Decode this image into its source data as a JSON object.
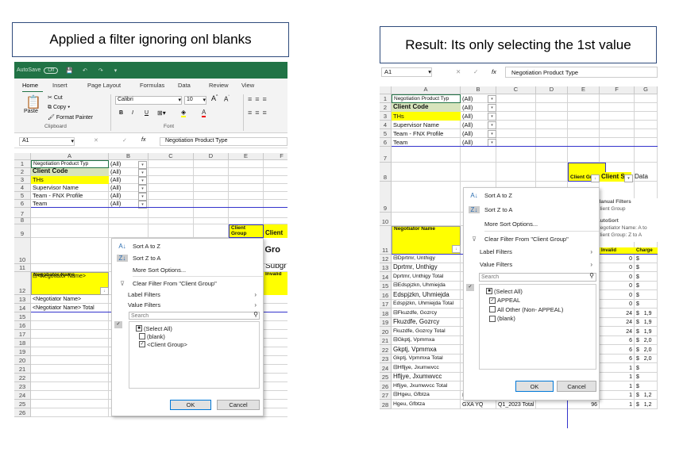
{
  "captions": {
    "left": "Applied a filter ignoring onl blanks",
    "right": "Result: Its only selecting the 1st value"
  },
  "colors": {
    "excel_green": "#217346",
    "header_yellow": "#ffff00",
    "pivot_border": "#3333cc"
  },
  "left": {
    "titlebar": {
      "autosave": "AutoSave",
      "toggle": "Off"
    },
    "tabs": [
      "Home",
      "Insert",
      "Page Layout",
      "Formulas",
      "Data",
      "Review",
      "View"
    ],
    "clipboard": {
      "paste": "Paste",
      "cut": "Cut",
      "copy": "Copy",
      "format_painter": "Format Painter",
      "group": "Clipboard"
    },
    "font": {
      "name": "Calibri",
      "size": "10",
      "group": "Font",
      "bold": "B",
      "italic": "I",
      "underline": "U"
    },
    "name_box": "A1",
    "formula": "Negotiation Product Type",
    "columns": [
      "A",
      "B",
      "C",
      "D",
      "E",
      "F"
    ],
    "filters": [
      {
        "label": "Negotiation Product Typ",
        "value": "(All)"
      },
      {
        "label": "Client Code",
        "value": "(All)"
      },
      {
        "label": "THs",
        "value": "(All)"
      },
      {
        "label": "Supervisor Name",
        "value": "(All)"
      },
      {
        "label": "Team - FNX Profile",
        "value": "(All)"
      },
      {
        "label": "Team",
        "value": "(All)"
      }
    ],
    "client_group_header": "Client Group",
    "client_partial": "Client",
    "title_partial": "nt Gro",
    "subgroup_partial": "Subgr",
    "negotiator_header": "Negotiator Name",
    "invalid_header": "Invalid",
    "rows": [
      "⊟<Negotiator Name>",
      "<Negotiator Name>",
      "<Negotiator Name> Total"
    ],
    "row_numbers": [
      "1",
      "2",
      "3",
      "4",
      "5",
      "6",
      "7",
      "8",
      "9",
      "10",
      "11",
      "12",
      "13",
      "14",
      "15",
      "16",
      "17",
      "18",
      "19",
      "20",
      "21",
      "22",
      "23",
      "24",
      "25",
      "26"
    ],
    "menu": {
      "sort_az": "Sort A to Z",
      "sort_za": "Sort Z to A",
      "more_sort": "More Sort Options...",
      "clear_filter": "Clear Filter From \"Client Group\"",
      "label_filters": "Label Filters",
      "value_filters": "Value Filters",
      "search_placeholder": "Search",
      "items": [
        {
          "label": "(Select All)",
          "state": "partial"
        },
        {
          "label": "(blank)",
          "state": "unchecked"
        },
        {
          "label": "<Client Group>",
          "state": "checked"
        }
      ],
      "ok": "OK",
      "cancel": "Cancel"
    }
  },
  "right": {
    "name_box": "A1",
    "formula": "Negotiation Product Type",
    "columns": [
      "A",
      "B",
      "C",
      "D",
      "E",
      "F",
      "G"
    ],
    "filters": [
      {
        "label": "Negotiation Product Typ",
        "value": "(All)"
      },
      {
        "label": "Client Code",
        "value": "(All)"
      },
      {
        "label": "THs",
        "value": "(All)"
      },
      {
        "label": "Supervisor Name",
        "value": "(All)"
      },
      {
        "label": "Team - FNX Profile",
        "value": "(All)"
      },
      {
        "label": "Team",
        "value": "(All)"
      }
    ],
    "client_group_header": "Client Group",
    "client_s_header": "Client S",
    "data_header": "Data",
    "negotiator_header": "Negotiator Name",
    "invalid_partial": "Invalid",
    "charge_partial": "Charge",
    "tooltip": [
      "Manual Filters",
      "Client Group",
      "AutoSort",
      "Negotiator Name: A to",
      "Client Group: Z to A"
    ],
    "row_numbers": [
      "1",
      "2",
      "3",
      "4",
      "5",
      "6",
      "7",
      "8",
      "9",
      "10",
      "11",
      "12",
      "13",
      "14",
      "15",
      "16",
      "17",
      "18",
      "19",
      "20",
      "21",
      "22",
      "23",
      "24",
      "25",
      "26",
      "27",
      "28"
    ],
    "rows": [
      {
        "a": "⊟Dprtmr, Unthigy",
        "f": "0",
        "g": "$"
      },
      {
        "a": "Dprtmr, Unthigy",
        "f": "0",
        "g": "$"
      },
      {
        "a": "Dprtmr, Unthigy Total",
        "f": "0",
        "g": "$"
      },
      {
        "a": "⊟Edspjzkn, Uhmiejda",
        "f": "0",
        "g": "$"
      },
      {
        "a": "Edspjzkn, Uhmiejda",
        "f": "0",
        "g": "$"
      },
      {
        "a": "Edspjzkn, Uhmiejda Total",
        "f": "0",
        "g": "$"
      },
      {
        "a": "⊟Fkuzdfe, Gozrcy",
        "f": "24",
        "g": "$   1,9"
      },
      {
        "a": "Fkuzdfe, Gozrcy",
        "f": "24",
        "g": "$   1,9"
      },
      {
        "a": "Fkuzdfe, Gozrcy Total",
        "f": "24",
        "g": "$   1,9"
      },
      {
        "a": "⊟Gkptj, Vpmmxa",
        "f": "6",
        "g": "$   2,0"
      },
      {
        "a": "Gkptj, Vpmmxa",
        "f": "6",
        "g": "$   2,0"
      },
      {
        "a": "Gkptj, Vpmmxa Total",
        "f": "6",
        "g": "$   2,0"
      },
      {
        "a": "⊟Hfljye, Jxumwvcc",
        "f": "1",
        "g": "$"
      },
      {
        "a": "Hfljye, Jxumwvcc",
        "f": "1",
        "g": "$"
      },
      {
        "a": "Hfljye, Jxumwvcc Total",
        "e": "1",
        "f": "1",
        "g": "$"
      },
      {
        "a": "⊟Hgeu, Gfbtza",
        "b": "⊟GXA YQ",
        "c": "⊟Q1_2023",
        "d": "Jan 2023",
        "e": "96",
        "f": "1",
        "g": "$   1,2"
      },
      {
        "a": "Hgeu, Gfbtza",
        "b": "GXA YQ",
        "c": "Q1_2023 Total",
        "e": "96",
        "f": "1",
        "g": "$   1,2"
      }
    ],
    "menu": {
      "sort_az": "Sort A to Z",
      "sort_za": "Sort Z to A",
      "more_sort": "More Sort Options...",
      "clear_filter": "Clear Filter From \"Client Group\"",
      "label_filters": "Label Filters",
      "value_filters": "Value Filters",
      "search_placeholder": "Search",
      "items": [
        {
          "label": "(Select All)",
          "state": "partial"
        },
        {
          "label": "APPEAL",
          "state": "checked"
        },
        {
          "label": "All Other (Non- APPEAL)",
          "state": "unchecked"
        },
        {
          "label": "(blank)",
          "state": "unchecked"
        }
      ],
      "ok": "OK",
      "cancel": "Cancel"
    }
  }
}
